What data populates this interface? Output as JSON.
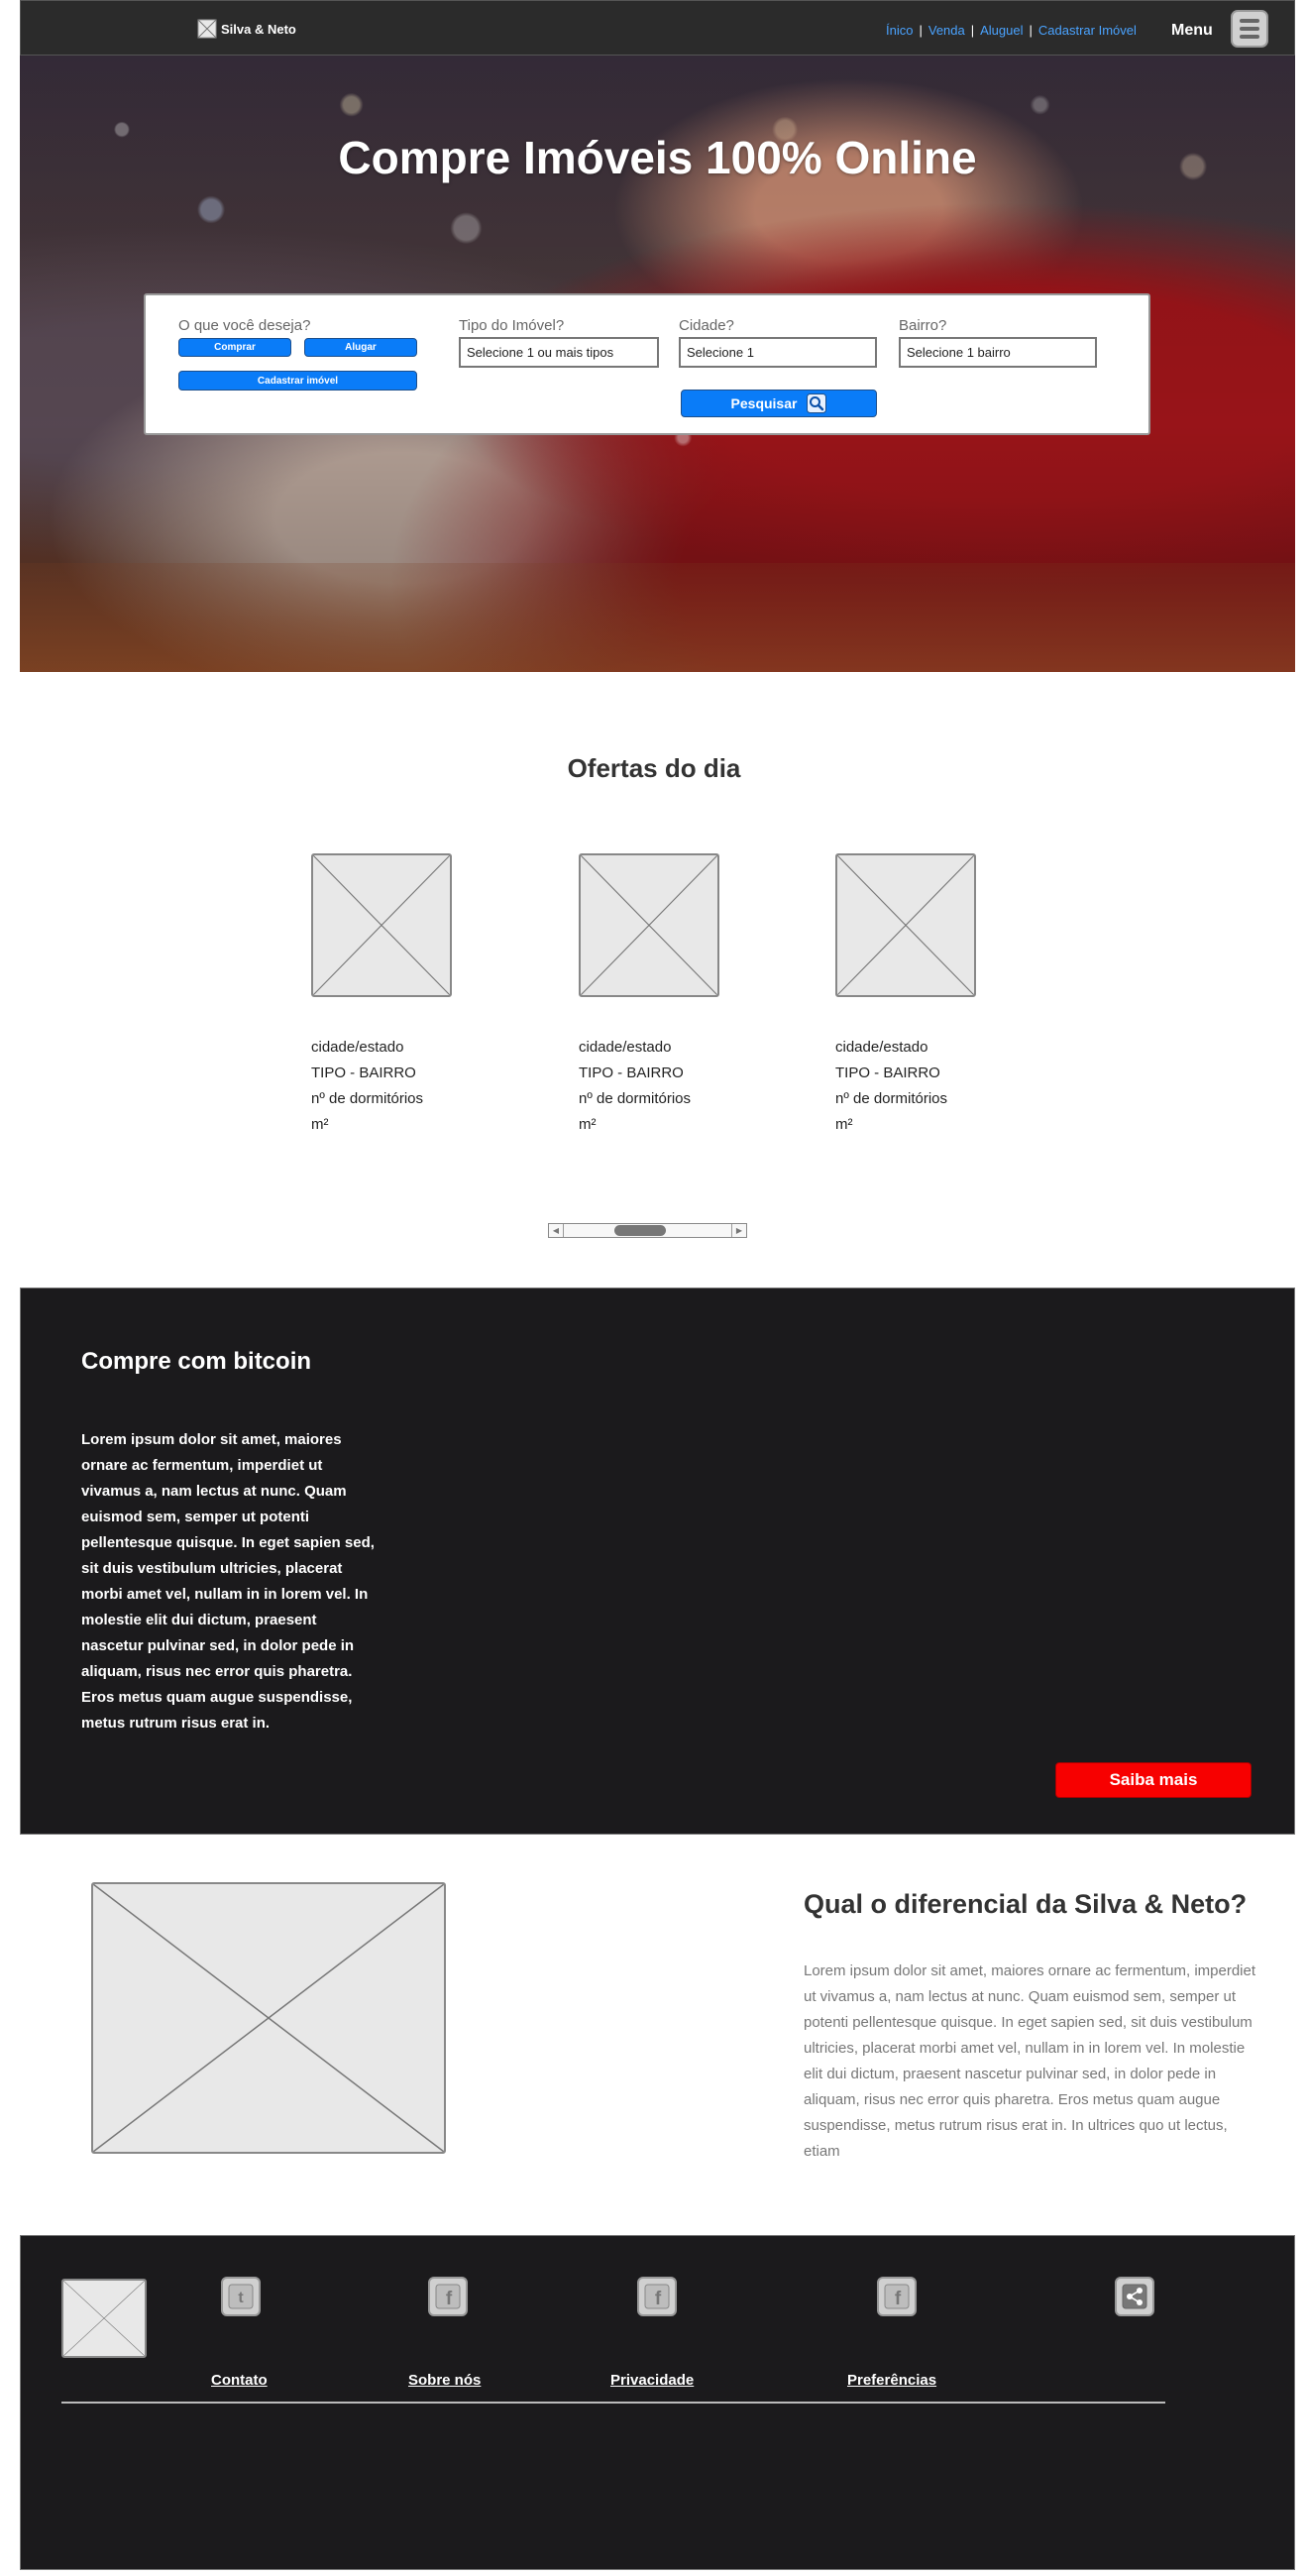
{
  "header": {
    "brand": "Silva & Neto",
    "nav": [
      "Ínico",
      "Venda",
      "Aluguel",
      "Cadastrar Imóvel"
    ],
    "menu_label": "Menu"
  },
  "hero": {
    "title": "Compre Imóveis 100% Online",
    "search": {
      "question_label": "O que você deseja?",
      "buy_label": "Comprar",
      "rent_label": "Alugar",
      "register_label": "Cadastrar imóvel",
      "type_label": "Tipo do Imóvel?",
      "type_value": "Selecione 1 ou mais tipos",
      "city_label": "Cidade?",
      "city_value": "Selecione 1",
      "district_label": "Bairro?",
      "district_value": "Selecione 1 bairro",
      "search_label": "Pesquisar"
    }
  },
  "offers": {
    "title": "Ofertas do dia",
    "items": [
      {
        "city": "cidade/estado",
        "type": "TIPO - BAIRRO",
        "rooms": "nº de dormitórios",
        "area": "m²"
      },
      {
        "city": "cidade/estado",
        "type": "TIPO - BAIRRO",
        "rooms": "nº de dormitórios",
        "area": "m²"
      },
      {
        "city": "cidade/estado",
        "type": "TIPO - BAIRRO",
        "rooms": "nº de dormitórios",
        "area": "m²"
      }
    ]
  },
  "bitcoin": {
    "title": "Compre com bitcoin",
    "text": "Lorem ipsum dolor sit amet, maiores ornare ac fermentum, imperdiet ut vivamus a, nam lectus at nunc. Quam euismod sem, semper ut potenti pellentesque quisque. In eget sapien sed, sit duis vestibulum ultricies, placerat morbi amet vel, nullam in in lorem vel. In molestie elit dui dictum, praesent nascetur pulvinar sed, in dolor pede in aliquam, risus nec error quis pharetra. Eros metus quam augue suspendisse, metus rutrum risus erat in.",
    "button": "Saiba mais",
    "button_color": "#f70000"
  },
  "differential": {
    "title": "Qual o diferencial da Silva & Neto?",
    "text": "Lorem ipsum dolor sit amet, maiores ornare ac fermentum, imperdiet ut vivamus a, nam lectus at nunc. Quam euismod sem, semper ut potenti pellentesque quisque. In eget sapien sed, sit duis vestibulum ultricies, placerat morbi amet vel, nullam in in lorem vel. In molestie elit dui dictum, praesent nascetur pulvinar sed, in dolor pede in aliquam, risus nec error quis pharetra. Eros metus quam augue suspendisse, metus rutrum risus erat in. In ultrices quo ut lectus, etiam"
  },
  "footer": {
    "social_icons": [
      "twitter-icon",
      "facebook-icon",
      "facebook-icon",
      "facebook-icon",
      "share-icon"
    ],
    "links": [
      "Contato",
      "Sobre nós",
      "Privacidade",
      "Preferências"
    ]
  },
  "colors": {
    "accent_blue": "#0a7cf8",
    "link_blue": "#4aa3ff",
    "dark_bg": "#1b1a1c",
    "header_bg": "#2b2b2b"
  }
}
